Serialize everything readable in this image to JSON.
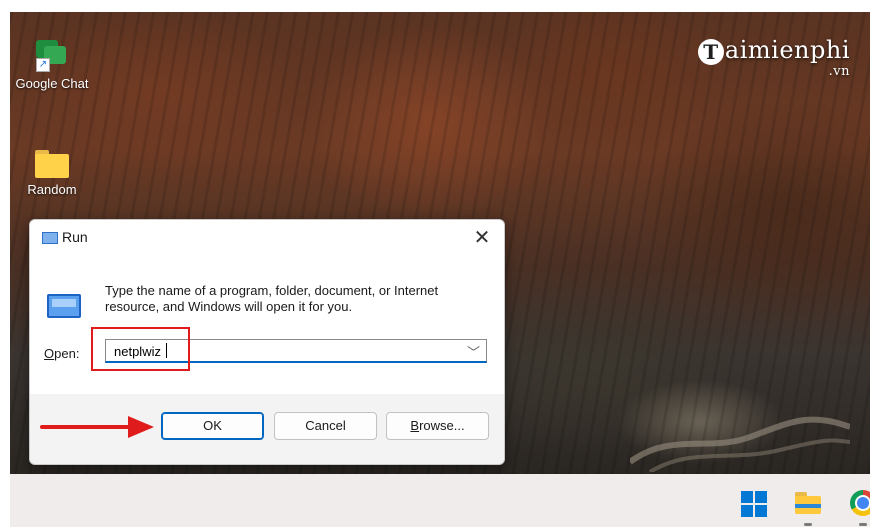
{
  "desktop": {
    "icons": [
      {
        "label": "Google Chat",
        "icon": "google-chat-icon"
      },
      {
        "label": "Random",
        "icon": "folder-icon"
      }
    ],
    "watermark": {
      "text": "aimienphi",
      "initial": "T",
      "suffix": ".vn"
    }
  },
  "run_dialog": {
    "title": "Run",
    "close_glyph": "✕",
    "description": "Type the name of a program, folder, document, or Internet resource, and Windows will open it for you.",
    "open_label_underlined": "O",
    "open_label_rest": "pen:",
    "command_value": "netplwiz",
    "buttons": {
      "ok": "OK",
      "cancel": "Cancel",
      "browse_underlined": "B",
      "browse_rest": "rowse..."
    }
  },
  "annotations": {
    "highlight_color": "#e01b1b",
    "arrow_color": "#e01b1b"
  },
  "taskbar": {
    "items": [
      "windows-start-icon",
      "file-explorer-icon",
      "chrome-icon"
    ]
  },
  "colors": {
    "accent": "#0067c0",
    "dialog_bg": "#f3f3f3",
    "taskbar_bg": "#f0ecec"
  }
}
